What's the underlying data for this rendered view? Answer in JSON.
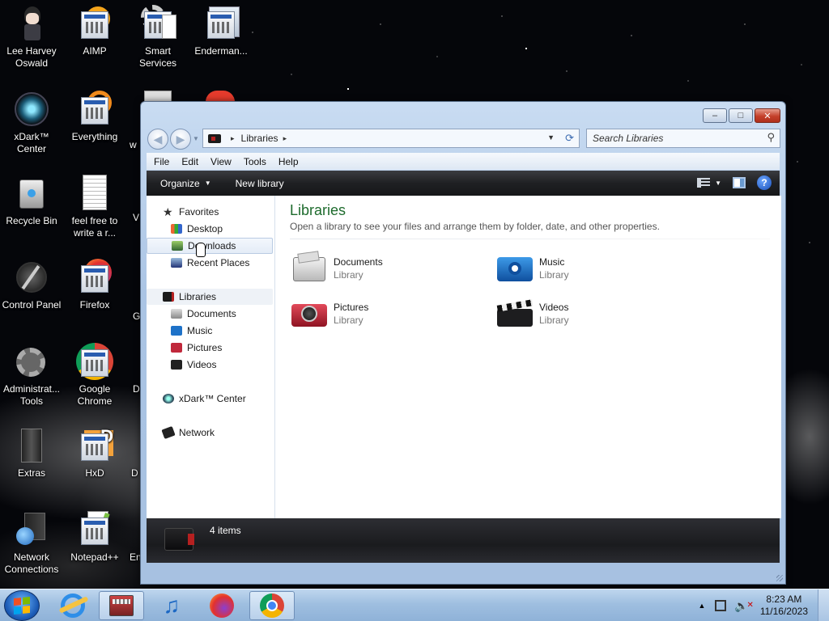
{
  "desktop": {
    "icons": [
      {
        "label": "Lee Harvey Oswald",
        "icon": "character-icon"
      },
      {
        "label": "AIMP",
        "icon": "aimp-icon"
      },
      {
        "label": "Smart Services",
        "icon": "services-icon"
      },
      {
        "label": "Enderman...",
        "icon": "app-icon"
      },
      {
        "label": "xDark™ Center",
        "icon": "xdark-icon"
      },
      {
        "label": "Everything",
        "icon": "everything-icon"
      },
      {
        "label": "Recycle Bin",
        "icon": "recycle-bin-icon"
      },
      {
        "label": "feel free to write a r...",
        "icon": "text-document-icon"
      },
      {
        "label": "Control Panel",
        "icon": "control-panel-icon"
      },
      {
        "label": "Firefox",
        "icon": "firefox-icon"
      },
      {
        "label": "Administrat... Tools",
        "icon": "admin-tools-icon"
      },
      {
        "label": "Google Chrome",
        "icon": "chrome-icon"
      },
      {
        "label": "Extras",
        "icon": "extras-icon"
      },
      {
        "label": "HxD",
        "icon": "hxd-icon"
      },
      {
        "label": "Network Connections",
        "icon": "network-connections-icon"
      },
      {
        "label": "Notepad++",
        "icon": "notepadpp-icon"
      }
    ],
    "partial_labels": [
      "w",
      "V",
      "G",
      "D",
      "D",
      "En"
    ]
  },
  "window": {
    "title_buttons": {
      "minimize": "–",
      "maximize": "□",
      "close": "✕"
    },
    "address": {
      "root": "Libraries",
      "sep": "▸"
    },
    "search_placeholder": "Search Libraries",
    "menu": [
      "File",
      "Edit",
      "View",
      "Tools",
      "Help"
    ],
    "commands": {
      "organize": "Organize",
      "new_library": "New library"
    },
    "nav": {
      "favorites": "Favorites",
      "favorites_items": [
        "Desktop",
        "Downloads",
        "Recent Places"
      ],
      "libraries": "Libraries",
      "libraries_items": [
        "Documents",
        "Music",
        "Pictures",
        "Videos"
      ],
      "xdark": "xDark™ Center",
      "network": "Network"
    },
    "content": {
      "title": "Libraries",
      "subtitle": "Open a library to see your files and arrange them by folder, date, and other properties.",
      "libraries": [
        {
          "name": "Documents",
          "type": "Library"
        },
        {
          "name": "Music",
          "type": "Library"
        },
        {
          "name": "Pictures",
          "type": "Library"
        },
        {
          "name": "Videos",
          "type": "Library"
        }
      ]
    },
    "status": {
      "count": "4 items"
    }
  },
  "taskbar": {
    "apps": [
      "internet-explorer-icon",
      "library-icon",
      "music-note-icon",
      "firefox-icon",
      "chrome-icon"
    ],
    "active_app": "library-icon",
    "time": "8:23 AM",
    "date": "11/16/2023"
  },
  "colors": {
    "accent_green": "#1e6b2d",
    "close_red": "#c4402a",
    "folder_red": "#b52020"
  }
}
